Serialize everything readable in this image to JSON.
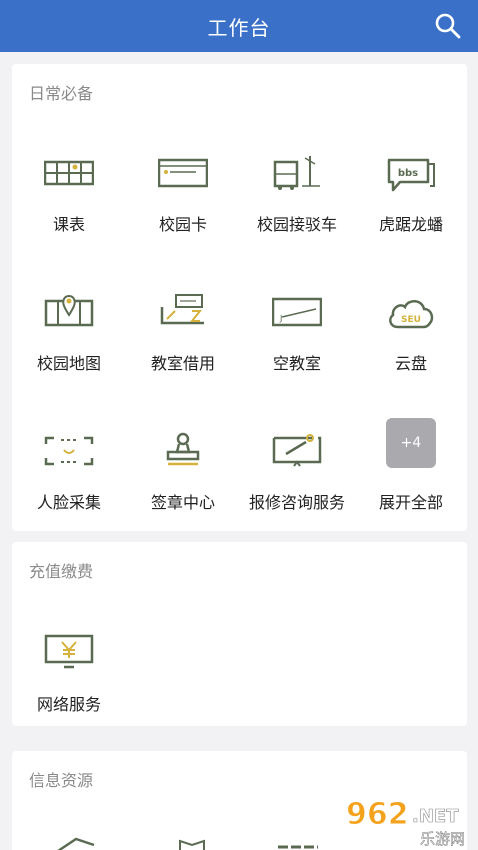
{
  "header": {
    "title": "工作台"
  },
  "sections": [
    {
      "title": "日常必备",
      "items": [
        {
          "label": "课表",
          "icon": "timetable-icon"
        },
        {
          "label": "校园卡",
          "icon": "campus-card-icon"
        },
        {
          "label": "校园接驳车",
          "icon": "shuttle-bus-icon"
        },
        {
          "label": "虎踞龙蟠",
          "icon": "bbs-icon"
        },
        {
          "label": "校园地图",
          "icon": "campus-map-icon"
        },
        {
          "label": "教室借用",
          "icon": "classroom-booking-icon"
        },
        {
          "label": "空教室",
          "icon": "empty-classroom-icon"
        },
        {
          "label": "云盘",
          "icon": "cloud-drive-icon"
        },
        {
          "label": "人脸采集",
          "icon": "face-capture-icon"
        },
        {
          "label": "签章中心",
          "icon": "stamp-icon"
        },
        {
          "label": "报修咨询服务",
          "icon": "repair-icon"
        },
        {
          "label": "展开全部",
          "badge": "+4",
          "icon": "expand-all-icon"
        }
      ]
    },
    {
      "title": "充值缴费",
      "items": [
        {
          "label": "网络服务",
          "icon": "network-service-icon"
        }
      ]
    },
    {
      "title": "信息资源",
      "items": []
    }
  ],
  "watermark": {
    "number": "962",
    "dot_net": ".NET",
    "sub": "乐游网"
  },
  "colors": {
    "header": "#3a70c8",
    "icon_olive": "#5a6b52",
    "icon_gold": "#d4b23c"
  }
}
